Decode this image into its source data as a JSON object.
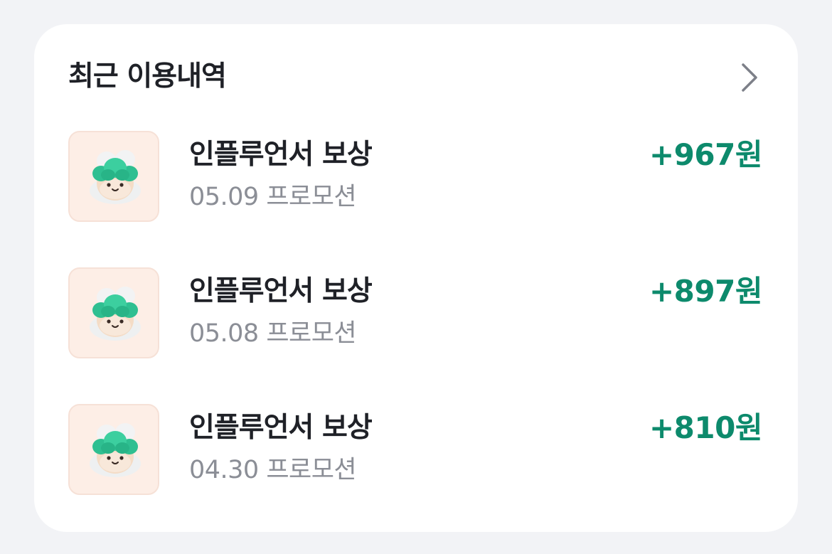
{
  "card": {
    "title": "최근 이용내역",
    "more_icon": "chevron-right-icon"
  },
  "transactions": [
    {
      "title": "인플루언서 보상",
      "subtitle": "05.09 프로모션",
      "amount": "+967원",
      "icon": "mascot-icon"
    },
    {
      "title": "인플루언서 보상",
      "subtitle": "05.08 프로모션",
      "amount": "+897원",
      "icon": "mascot-icon"
    },
    {
      "title": "인플루언서 보상",
      "subtitle": "04.30 프로모션",
      "amount": "+810원",
      "icon": "mascot-icon"
    }
  ],
  "colors": {
    "background": "#f2f3f6",
    "card": "#ffffff",
    "amount": "#0d8a6c",
    "title_text": "#1f2127",
    "sub_text": "#8b8e96",
    "thumb_bg": "#fdeee6"
  }
}
